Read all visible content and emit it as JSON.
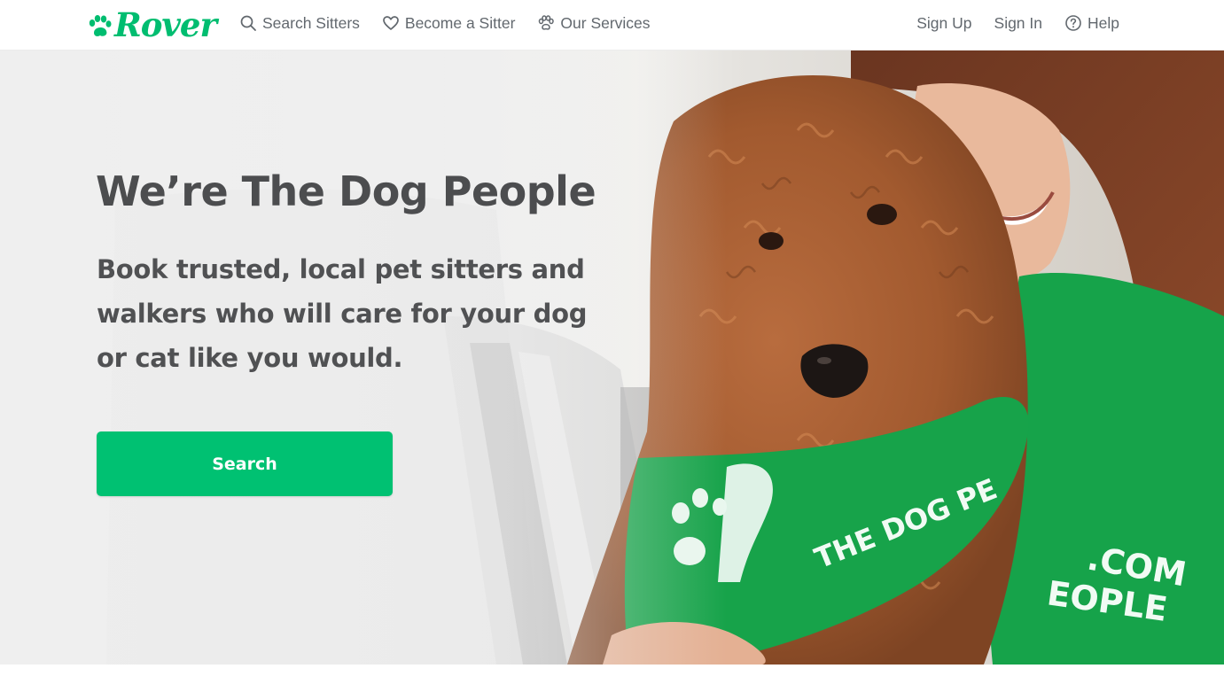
{
  "header": {
    "logo_text": "Rover",
    "brand_color": "#00bd70",
    "nav_left": [
      {
        "label": "Search Sitters",
        "icon": "search-icon"
      },
      {
        "label": "Become a Sitter",
        "icon": "heart-icon"
      },
      {
        "label": "Our Services",
        "icon": "paw-icon"
      }
    ],
    "nav_right": [
      {
        "label": "Sign Up"
      },
      {
        "label": "Sign In"
      },
      {
        "label": "Help",
        "icon": "help-circle-icon"
      }
    ]
  },
  "hero": {
    "title": "We’re The Dog People",
    "subtitle": "Book trusted, local pet sitters and walkers who will care for your dog or cat like you would.",
    "search_button_label": "Search",
    "button_color": "#00c172",
    "image_text": [
      "THE DOG PE",
      ".COM",
      "EOPLE"
    ]
  }
}
